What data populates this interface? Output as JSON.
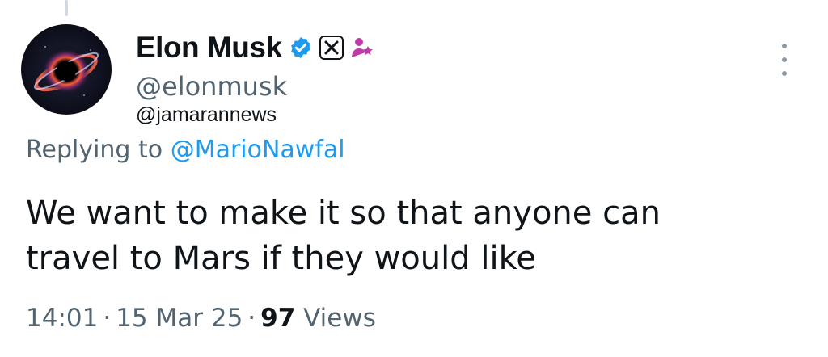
{
  "tweet": {
    "author": {
      "display_name": "Elon Musk",
      "handle": "@elonmusk",
      "verified_badge_icon": "verified-check-icon",
      "affiliation_icon": "x-logo-icon",
      "extra_icon": "person-star-icon"
    },
    "watermark": "@jamarannews",
    "replying": {
      "prefix": "Replying to",
      "mention": "@MarioNawfal"
    },
    "text_lines": [
      "We want to make it so that anyone can",
      "travel to Mars if they would like"
    ],
    "meta": {
      "time": "14:01",
      "date": "15 Mar 25",
      "views_count": "97",
      "views_label": "Views"
    },
    "more_icon": "more-vertical-icon"
  },
  "colors": {
    "text_primary": "#0f1419",
    "text_secondary": "#536471",
    "link": "#1d9bf0",
    "verified": "#1d9bf0",
    "person_star": "#c13ba8"
  }
}
